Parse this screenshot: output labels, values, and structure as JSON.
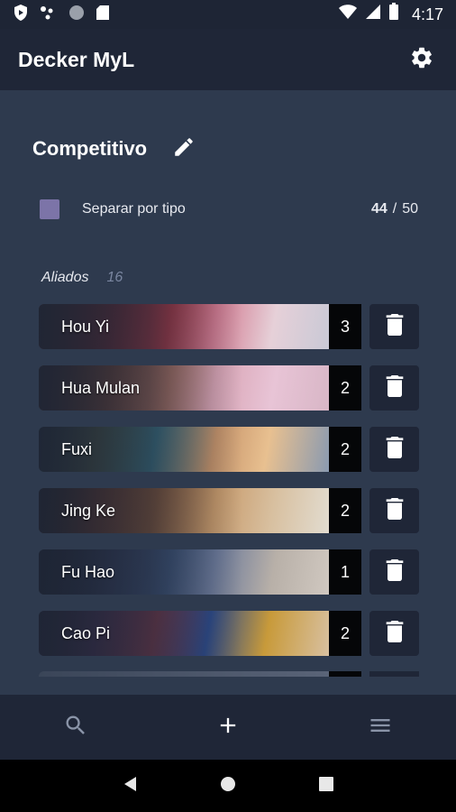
{
  "status_bar": {
    "time": "4:17",
    "icons": [
      "shield-icon",
      "dots-icon",
      "circle-icon",
      "sd-card-icon",
      "wifi-icon",
      "signal-icon",
      "battery-icon"
    ]
  },
  "app_bar": {
    "title": "Decker MyL",
    "settings_icon": "gear-icon"
  },
  "deck": {
    "name": "Competitivo",
    "edit_icon": "pencil-icon",
    "separator_label": "Separar por tipo",
    "separator_checked": true,
    "count_current": "44",
    "count_separator": "/",
    "count_max": "50"
  },
  "section": {
    "title": "Aliados",
    "count": "16"
  },
  "cards": [
    {
      "name": "Hou Yi",
      "qty": "3"
    },
    {
      "name": "Hua Mulan",
      "qty": "2"
    },
    {
      "name": "Fuxi",
      "qty": "2"
    },
    {
      "name": "Jing Ke",
      "qty": "2"
    },
    {
      "name": "Fu Hao",
      "qty": "1"
    },
    {
      "name": "Cao Pi",
      "qty": "2"
    }
  ],
  "bottom_nav": {
    "items": [
      "search-icon",
      "add-icon",
      "menu-icon"
    ]
  },
  "system_nav": {
    "items": [
      "back-icon",
      "home-icon",
      "recents-icon"
    ]
  },
  "colors": {
    "background": "#2e3a4e",
    "bar": "#1f2637",
    "checkbox": "#7c74a8",
    "qty_box": "#050608"
  }
}
